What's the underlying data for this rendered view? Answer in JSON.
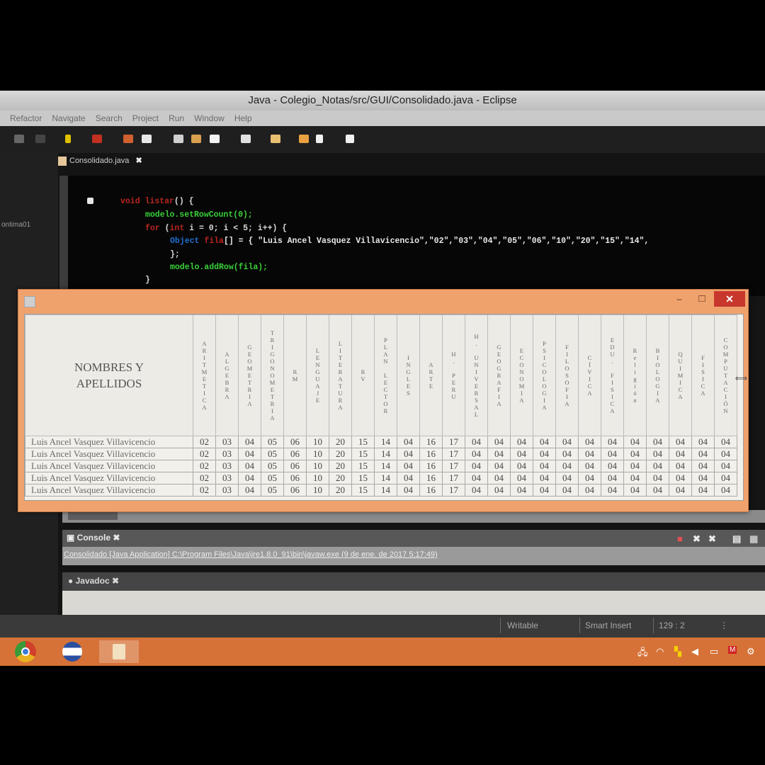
{
  "window": {
    "title": "Java - Colegio_Notas/src/GUI/Consolidado.java - Eclipse"
  },
  "menu": [
    "Refactor",
    "Navigate",
    "Search",
    "Project",
    "Run",
    "Window",
    "Help"
  ],
  "editor": {
    "tab": "Consolidado.java",
    "left_label": "ontima01",
    "code": {
      "l1_kw": "void",
      "l1_name": " listar",
      "l1_rest": "() {",
      "l2": "modelo.setRowCount(0);",
      "l3_kw": "for",
      "l3_a": " (",
      "l3_int": "int",
      "l3_b": " i = 0; i < 5; i++) {",
      "l4_type": "Object",
      "l4_var": " fila",
      "l4_rest": "[] = { \"Luis Ancel Vasquez Villavicencio\",\"02\",\"03\",\"04\",\"05\",\"06\",\"10\",\"20\",\"15\",\"14\",",
      "l5": "};",
      "l6": "modelo.addRow(fila);",
      "l7": "}"
    }
  },
  "dialog": {
    "close_label": "✕",
    "minimize_label": "–",
    "maximize_label": "□",
    "name_header_1": "NOMBRES Y",
    "name_header_2": "APELLIDOS",
    "columns": [
      "ARITMETICA",
      "ALGEBRA",
      "GEOMETRIA",
      "TRIGONOMETRIA",
      "RM",
      "LENGUAJE",
      "LITERATURA",
      "RV",
      "PLAN LECTOR",
      "INGLES",
      "ARTE",
      "H. PERU",
      "H. UNIVERSAL",
      "GEOGRAFIA",
      "ECONOMIA",
      "PSICOLOGIA",
      "FILOSOFIA",
      "CÍVICA",
      "EDU. FISICA",
      "Religión",
      "BIOLOGIA",
      "QUIMICA",
      "FISICA",
      "COMPUTACIÓN"
    ],
    "rows": [
      {
        "name": "Luis Ancel Vasquez Villavicencio",
        "values": [
          "02",
          "03",
          "04",
          "05",
          "06",
          "10",
          "20",
          "15",
          "14",
          "04",
          "16",
          "17",
          "04",
          "04",
          "04",
          "04",
          "04",
          "04",
          "04",
          "04",
          "04",
          "04",
          "04",
          "04"
        ]
      },
      {
        "name": "Luis Ancel Vasquez Villavicencio",
        "values": [
          "02",
          "03",
          "04",
          "05",
          "06",
          "10",
          "20",
          "15",
          "14",
          "04",
          "16",
          "17",
          "04",
          "04",
          "04",
          "04",
          "04",
          "04",
          "04",
          "04",
          "04",
          "04",
          "04",
          "04"
        ]
      },
      {
        "name": "Luis Ancel Vasquez Villavicencio",
        "values": [
          "02",
          "03",
          "04",
          "05",
          "06",
          "10",
          "20",
          "15",
          "14",
          "04",
          "16",
          "17",
          "04",
          "04",
          "04",
          "04",
          "04",
          "04",
          "04",
          "04",
          "04",
          "04",
          "04",
          "04"
        ]
      },
      {
        "name": "Luis Ancel Vasquez Villavicencio",
        "values": [
          "02",
          "03",
          "04",
          "05",
          "06",
          "10",
          "20",
          "15",
          "14",
          "04",
          "16",
          "17",
          "04",
          "04",
          "04",
          "04",
          "04",
          "04",
          "04",
          "04",
          "04",
          "04",
          "04",
          "04"
        ]
      },
      {
        "name": "Luis Ancel Vasquez Villavicencio",
        "values": [
          "02",
          "03",
          "04",
          "05",
          "06",
          "10",
          "20",
          "15",
          "14",
          "04",
          "16",
          "17",
          "04",
          "04",
          "04",
          "04",
          "04",
          "04",
          "04",
          "04",
          "04",
          "04",
          "04",
          "04"
        ]
      }
    ]
  },
  "console": {
    "tab": "Console",
    "text": "Consolidado [Java Application] C:\\Program Files\\Java\\jre1.8.0_91\\bin\\javaw.exe (9 de ene. de 2017 5:17:49)"
  },
  "javadoc": {
    "tab": "Javadoc"
  },
  "status": {
    "writable": "Writable",
    "insert_mode": "Smart Insert",
    "position": "129 : 2"
  },
  "colors": {
    "dialog_frame": "#f0a26d",
    "taskbar": "#d67237",
    "close_button": "#c8372c"
  }
}
